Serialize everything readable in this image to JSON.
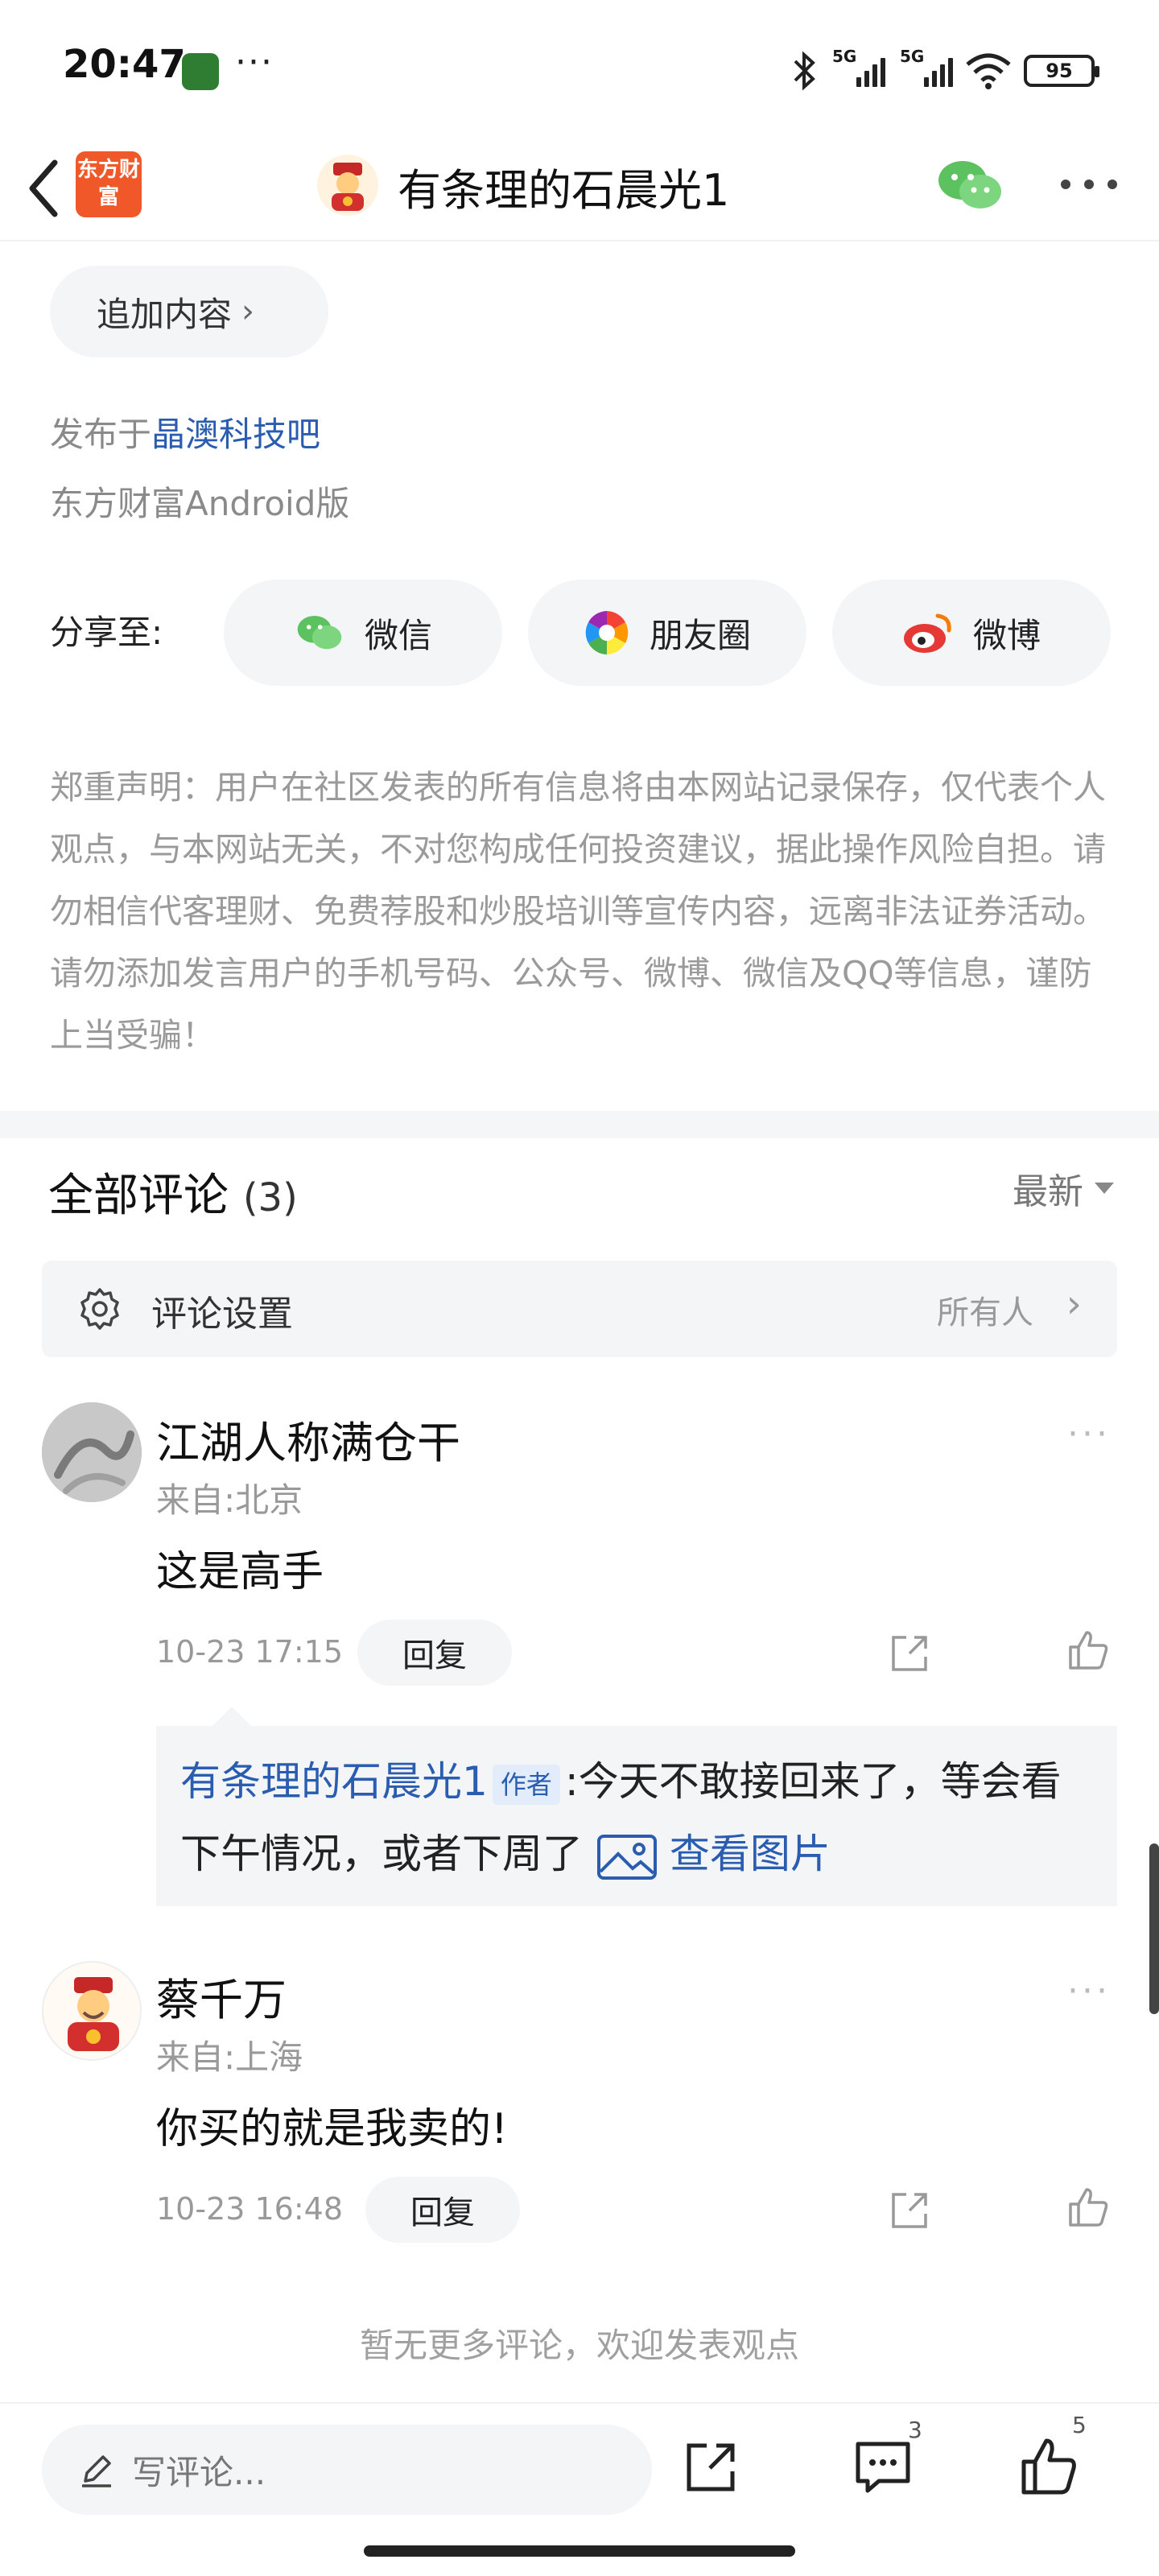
{
  "status_bar": {
    "time": "20:47",
    "more": "···",
    "network_1": "5G",
    "network_2": "5G",
    "battery": "95",
    "icons": [
      "bluetooth-icon",
      "signal-icon",
      "signal-icon",
      "wifi-icon",
      "battery-icon"
    ]
  },
  "header": {
    "brand_logo": "东方财富",
    "title": "有条理的石晨光1",
    "icons": [
      "back-icon",
      "wechat-icon",
      "more-icon"
    ]
  },
  "post": {
    "add_content_label": "追加内容",
    "published_prefix": "发布于",
    "published_forum": "晶澳科技吧",
    "platform": "东方财富Android版"
  },
  "share": {
    "label": "分享至:",
    "buttons": [
      {
        "label": "微信",
        "icon": "wechat-icon"
      },
      {
        "label": "朋友圈",
        "icon": "moments-icon"
      },
      {
        "label": "微博",
        "icon": "weibo-icon"
      }
    ]
  },
  "disclaimer": "郑重声明：用户在社区发表的所有信息将由本网站记录保存，仅代表个人观点，与本网站无关，不对您构成任何投资建议，据此操作风险自担。请勿相信代客理财、免费荐股和炒股培训等宣传内容，远离非法证券活动。请勿添加发言用户的手机号码、公众号、微博、微信及QQ等信息，谨防上当受骗！",
  "comments_section": {
    "title": "全部评论",
    "count": "(3)",
    "sort_label": "最新",
    "settings_label": "评论设置",
    "settings_value": "所有人"
  },
  "comments": [
    {
      "name": "江湖人称满仓干",
      "location": "来自:北京",
      "text": "这是高手",
      "time": "10-23 17:15",
      "reply_label": "回复",
      "nested_reply": {
        "author": "有条理的石晨光1",
        "tag": "作者",
        "text": ":今天不敢接回来了，等会看下午情况，或者下周了",
        "image_link": "查看图片"
      }
    },
    {
      "name": "蔡千万",
      "location": "来自:上海",
      "text": "你买的就是我卖的!",
      "time": "10-23 16:48",
      "reply_label": "回复"
    }
  ],
  "no_more": "暂无更多评论，欢迎发表观点",
  "bottom_bar": {
    "write_placeholder": "写评论...",
    "comment_count": "3",
    "like_count": "5"
  },
  "colors": {
    "link_blue": "#2a5db0",
    "brand_orange": "#f0582a",
    "pill_bg": "#f4f5f7"
  }
}
